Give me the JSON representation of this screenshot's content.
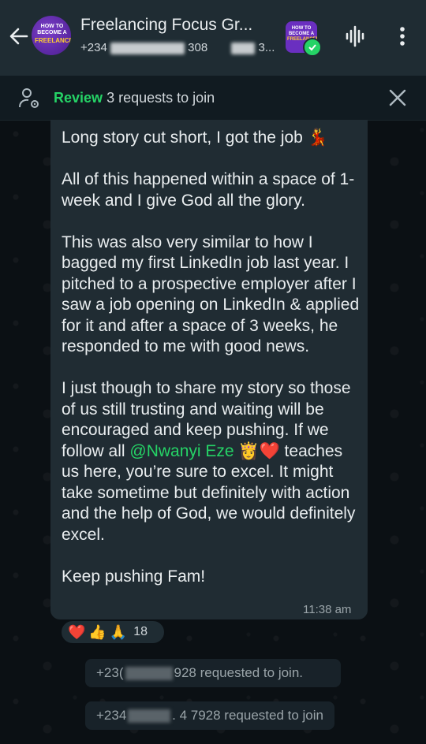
{
  "header": {
    "title": "Freelancing Focus Gr...",
    "subtitle_prefix": "+234",
    "subtitle_mid": "308",
    "subtitle_end": "3...",
    "avatar_text_top": "HOW TO BECOME A",
    "avatar_text_bottom": "FREELANCER"
  },
  "review_bar": {
    "link_label": "Review",
    "rest_label": "3 requests to join"
  },
  "message": {
    "paragraphs": [
      "Long story cut short, I got the job 💃",
      "All of this happened within a space of 1-week and I give God all the glory.",
      "This was also very similar to how I bagged my first LinkedIn job last year. I pitched to a prospective employer after I saw a job opening on LinkedIn & applied for it and after a space of 3 weeks, he responded to me with good news."
    ],
    "p4_before": "I just though to share my story so those of us still trusting and waiting will be encouraged and keep pushing. If we follow all ",
    "mention": "@Nwanyi Eze",
    "p4_emoji": " 👸❤️",
    "p4_after": " teaches us here, you’re sure to excel. It might take sometime but definitely with action and the help of God, we would definitely excel.",
    "closing": "Keep pushing Fam!",
    "time": "11:38 am"
  },
  "reactions": {
    "emojis": [
      "❤️",
      "👍",
      "🙏"
    ],
    "count": "18"
  },
  "system_messages": [
    {
      "prefix": "+23(",
      "suffix": "928 requested to join."
    },
    {
      "prefix": "+234",
      "suffix": ". 4 7928 requested to join"
    }
  ],
  "colors": {
    "accent_green": "#25d366",
    "header_bg": "#1f2c33",
    "bubble_bg": "#202c33",
    "chat_bg": "#0b1014"
  },
  "icons": [
    "back-arrow-icon",
    "waveform-icon",
    "more-vert-icon",
    "person-settings-icon",
    "close-icon",
    "check-icon"
  ]
}
